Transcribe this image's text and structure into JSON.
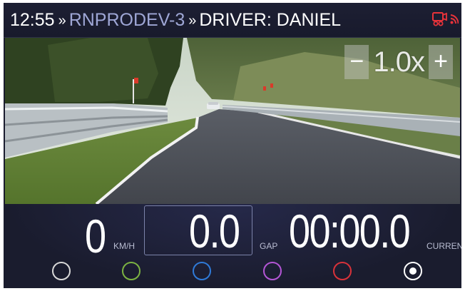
{
  "header": {
    "time": "12:55",
    "separator": "»",
    "device": "RNPRODEV-3",
    "driver_label": "DRIVER: DANIEL",
    "icons": [
      "video-record-icon",
      "signal-icon"
    ],
    "colors": {
      "device": "#9fa7d6",
      "alert": "#e8333a"
    }
  },
  "video": {
    "zoom": {
      "minus_label": "−",
      "value": "1.0x",
      "plus_label": "+"
    }
  },
  "stats": {
    "speed": {
      "value": "0",
      "unit": "KM/H"
    },
    "gap": {
      "value": "0.0",
      "unit": "GAP"
    },
    "time": {
      "value": "00:00.0",
      "unit": "CURRENT"
    }
  },
  "selectors": [
    {
      "name": "white",
      "color": "#d8d8d8",
      "selected": false
    },
    {
      "name": "green",
      "color": "#7cb342",
      "selected": false
    },
    {
      "name": "blue",
      "color": "#2f7ad8",
      "selected": false
    },
    {
      "name": "purple",
      "color": "#b456d6",
      "selected": false
    },
    {
      "name": "red",
      "color": "#d8323a",
      "selected": false
    },
    {
      "name": "white-selected",
      "color": "#ffffff",
      "selected": true
    }
  ]
}
